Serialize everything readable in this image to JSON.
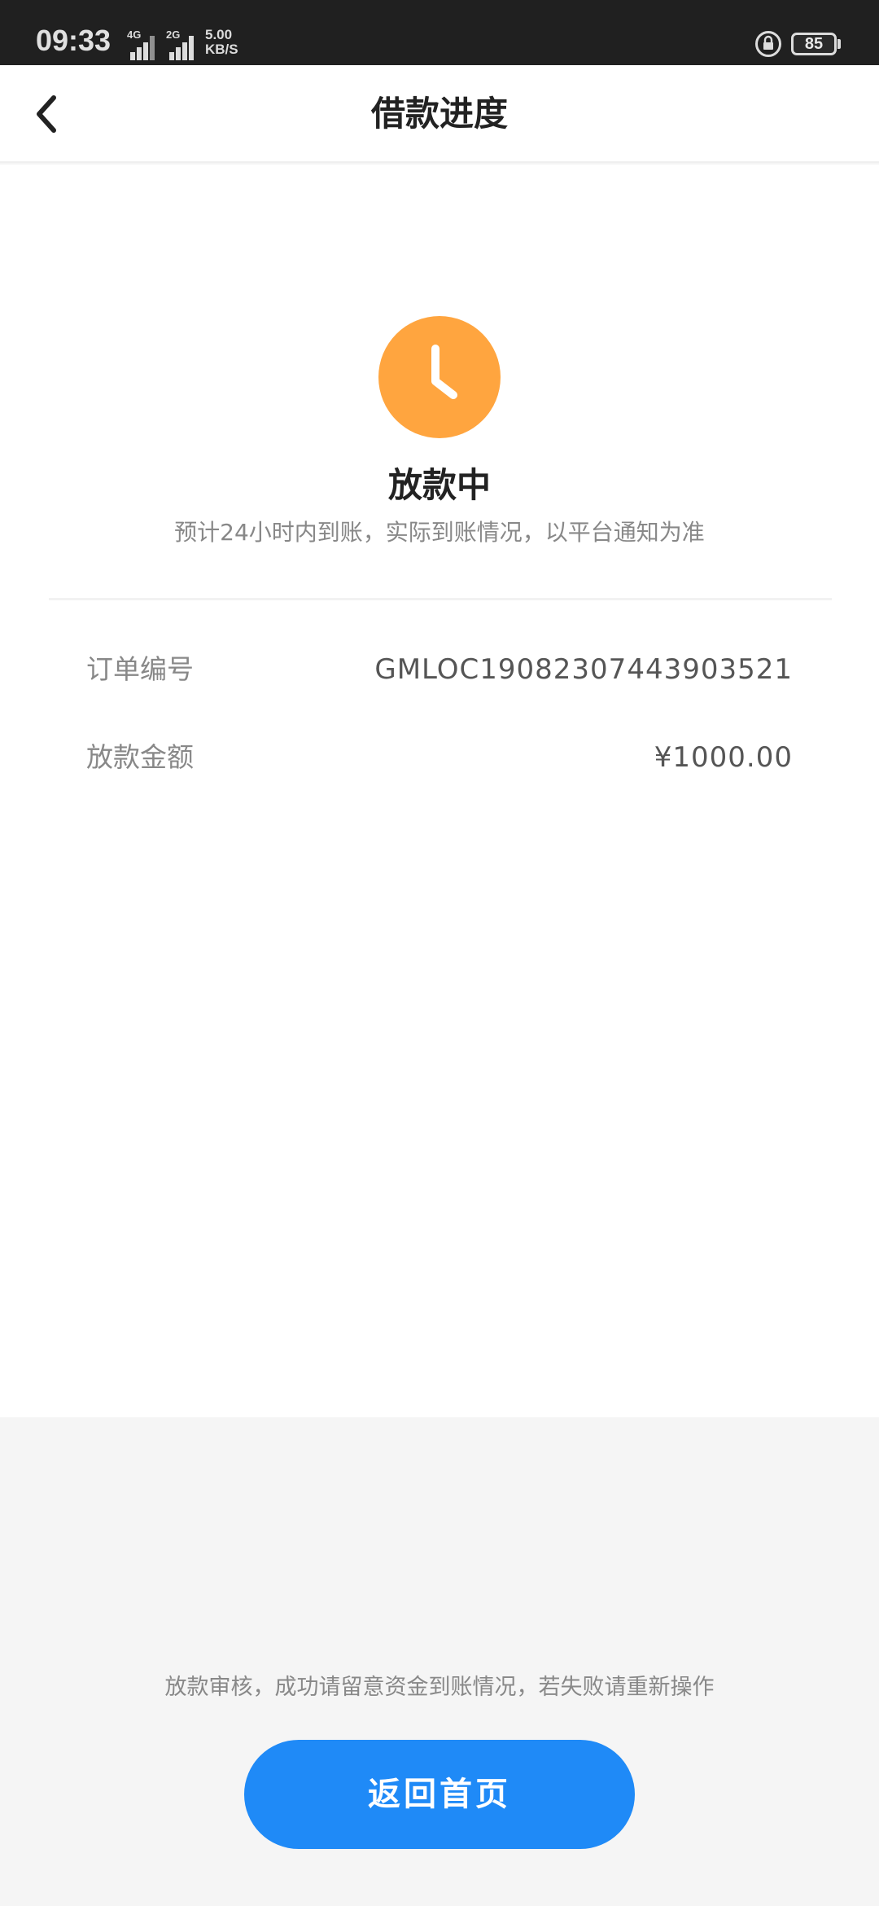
{
  "status_bar": {
    "time": "09:33",
    "network_1": "4G",
    "network_2": "2G",
    "speed_value": "5.00",
    "speed_unit": "KB/S",
    "battery": "85"
  },
  "header": {
    "title": "借款进度",
    "back_icon": "chevron-left-icon"
  },
  "status": {
    "icon": "clock-icon",
    "icon_color": "#ffa53f",
    "title": "放款中",
    "description": "预计24小时内到账，实际到账情况，以平台通知为准"
  },
  "details": {
    "order_label": "订单编号",
    "order_value": "GMLOC19082307443903521",
    "amount_label": "放款金额",
    "amount_value": "¥1000.00"
  },
  "footer": {
    "note": "放款审核，成功请留意资金到账情况，若失败请重新操作",
    "home_button": "返回首页",
    "button_color": "#1f8af7"
  }
}
